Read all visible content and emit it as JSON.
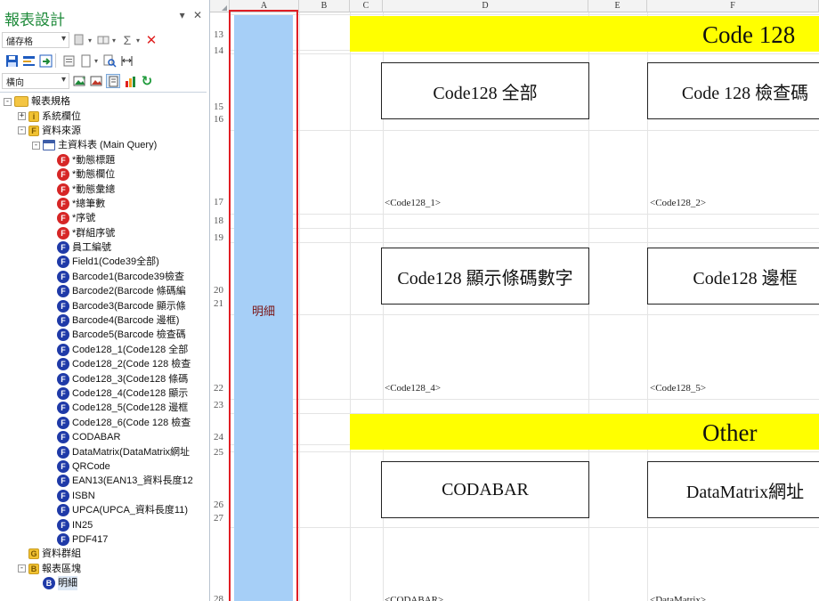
{
  "panel": {
    "title": "報表設計",
    "pin_icon": "▾",
    "close_icon": "✕",
    "toolbar1": {
      "select": "儲存格"
    },
    "toolbar3": {
      "select": "橫向"
    },
    "tree": [
      {
        "label": "報表規格",
        "depth": 0,
        "exp": "−",
        "icon": "folder"
      },
      {
        "label": "系統欄位",
        "depth": 1,
        "exp": "+",
        "icon": "gold",
        "glyph": "i"
      },
      {
        "label": "資料來源",
        "depth": 1,
        "exp": "−",
        "icon": "gold",
        "glyph": "F"
      },
      {
        "label": "主資料表 (Main Query)",
        "depth": 2,
        "exp": "−",
        "icon": "table"
      },
      {
        "label": "*動態標題",
        "depth": 3,
        "icon": "red",
        "glyph": "F"
      },
      {
        "label": "*動態欄位",
        "depth": 3,
        "icon": "red",
        "glyph": "F"
      },
      {
        "label": "*動態彙總",
        "depth": 3,
        "icon": "red",
        "glyph": "F"
      },
      {
        "label": "*總筆數",
        "depth": 3,
        "icon": "red",
        "glyph": "F"
      },
      {
        "label": "*序號",
        "depth": 3,
        "icon": "red",
        "glyph": "F"
      },
      {
        "label": "*群組序號",
        "depth": 3,
        "icon": "red",
        "glyph": "F"
      },
      {
        "label": "員工編號",
        "depth": 3,
        "icon": "blue",
        "glyph": "F"
      },
      {
        "label": "Field1(Code39全部)",
        "depth": 3,
        "icon": "blue",
        "glyph": "F"
      },
      {
        "label": "Barcode1(Barcode39檢查",
        "depth": 3,
        "icon": "blue",
        "glyph": "F"
      },
      {
        "label": "Barcode2(Barcode 條碼編",
        "depth": 3,
        "icon": "blue",
        "glyph": "F"
      },
      {
        "label": "Barcode3(Barcode  顯示條",
        "depth": 3,
        "icon": "blue",
        "glyph": "F"
      },
      {
        "label": "Barcode4(Barcode  邊框)",
        "depth": 3,
        "icon": "blue",
        "glyph": "F"
      },
      {
        "label": "Barcode5(Barcode 檢查碼",
        "depth": 3,
        "icon": "blue",
        "glyph": "F"
      },
      {
        "label": "Code128_1(Code128  全部",
        "depth": 3,
        "icon": "blue",
        "glyph": "F"
      },
      {
        "label": "Code128_2(Code 128  檢查",
        "depth": 3,
        "icon": "blue",
        "glyph": "F"
      },
      {
        "label": "Code128_3(Code128 條碼",
        "depth": 3,
        "icon": "blue",
        "glyph": "F"
      },
      {
        "label": "Code128_4(Code128 顯示",
        "depth": 3,
        "icon": "blue",
        "glyph": "F"
      },
      {
        "label": "Code128_5(Code128  邊框",
        "depth": 3,
        "icon": "blue",
        "glyph": "F"
      },
      {
        "label": "Code128_6(Code 128 檢查",
        "depth": 3,
        "icon": "blue",
        "glyph": "F"
      },
      {
        "label": "CODABAR",
        "depth": 3,
        "icon": "blue",
        "glyph": "F"
      },
      {
        "label": "DataMatrix(DataMatrix網址",
        "depth": 3,
        "icon": "blue",
        "glyph": "F"
      },
      {
        "label": "QRCode",
        "depth": 3,
        "icon": "blue",
        "glyph": "F"
      },
      {
        "label": "EAN13(EAN13_資料長度12",
        "depth": 3,
        "icon": "blue",
        "glyph": "F"
      },
      {
        "label": "ISBN",
        "depth": 3,
        "icon": "blue",
        "glyph": "F"
      },
      {
        "label": "UPCA(UPCA_資料長度11)",
        "depth": 3,
        "icon": "blue",
        "glyph": "F"
      },
      {
        "label": "IN25",
        "depth": 3,
        "icon": "blue",
        "glyph": "F"
      },
      {
        "label": "PDF417",
        "depth": 3,
        "icon": "blue",
        "glyph": "F"
      },
      {
        "label": "資料群組",
        "depth": 1,
        "icon": "gold",
        "glyph": "G"
      },
      {
        "label": "報表區塊",
        "depth": 1,
        "exp": "−",
        "icon": "gold",
        "glyph": "B"
      },
      {
        "label": "明細",
        "depth": 2,
        "icon": "blue",
        "glyph": "B",
        "selected": true
      }
    ]
  },
  "sheet": {
    "columns": [
      "A",
      "B",
      "C",
      "D",
      "E",
      "F"
    ],
    "row_numbers": [
      {
        "n": "13"
      },
      {
        "n": "14"
      },
      {
        "n": "15"
      },
      {
        "n": "16"
      },
      {
        "n": "17"
      },
      {
        "n": "18"
      },
      {
        "n": "19"
      },
      {
        "n": "20"
      },
      {
        "n": "21"
      },
      {
        "n": "22"
      },
      {
        "n": "23"
      },
      {
        "n": "24"
      },
      {
        "n": "25"
      },
      {
        "n": "26"
      },
      {
        "n": "27"
      },
      {
        "n": "28"
      }
    ],
    "detail_band_label": "明細",
    "sections": [
      {
        "title": "Code 128"
      },
      {
        "title": "Other"
      }
    ],
    "boxes": [
      {
        "text": "Code128  全部"
      },
      {
        "text": "Code 128  檢查碼"
      },
      {
        "text": "Code128 顯示條碼數字"
      },
      {
        "text": "Code128  邊框"
      },
      {
        "text": "CODABAR"
      },
      {
        "text": "DataMatrix網址"
      }
    ],
    "placeholders": [
      {
        "text": "<Code128_1>"
      },
      {
        "text": "<Code128_2>"
      },
      {
        "text": "<Code128_4>"
      },
      {
        "text": "<Code128_5>"
      },
      {
        "text": "<CODABAR>"
      },
      {
        "text": "<DataMatrix>"
      }
    ]
  }
}
